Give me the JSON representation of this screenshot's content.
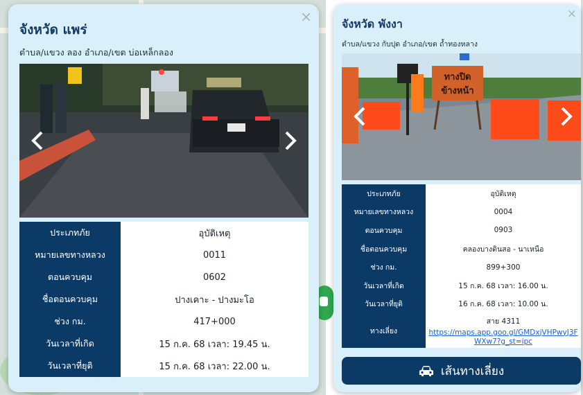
{
  "popups": [
    {
      "close_glyph": "×",
      "province": "จังหวัด แพร่",
      "location": "ตำบล/แขวง ลอง อำเภอ/เขต บ่อเหล็กลอง",
      "photo": "night-accident-road-photo",
      "rows": [
        {
          "label": "ประเภทภัย",
          "value": "อุบัติเหตุ"
        },
        {
          "label": "หมายเลขทางหลวง",
          "value": "0011"
        },
        {
          "label": "ตอนควบคุม",
          "value": "0602"
        },
        {
          "label": "ชื่อตอนควบคุม",
          "value": "ปางเคาะ - ปางมะโอ"
        },
        {
          "label": "ช่วง กม.",
          "value": "417+000"
        },
        {
          "label": "วันเวลาที่เกิด",
          "value": "15 ก.ค. 68 เวลา: 19.45 น."
        },
        {
          "label": "วันเวลาที่ยุติ",
          "value": "15 ก.ค. 68 เวลา: 22.00 น."
        }
      ]
    },
    {
      "close_glyph": "×",
      "province": "จังหวัด พังงา",
      "location": "ตำบล/แขวง กับปุด อำเภอ/เขต ถ้ำทองหลาง",
      "photo": "road-closure-barrier-photo",
      "sign_text": [
        "ทางปิด",
        "ข้างหน้า"
      ],
      "rows": [
        {
          "label": "ประเภทภัย",
          "value": "อุบัติเหตุ"
        },
        {
          "label": "หมายเลขทางหลวง",
          "value": "0004"
        },
        {
          "label": "ตอนควบคุม",
          "value": "0903"
        },
        {
          "label": "ชื่อตอนควบคุม",
          "value": "คลองบางดินสอ - นาเหนือ"
        },
        {
          "label": "ช่วง กม.",
          "value": "899+300"
        },
        {
          "label": "วันเวลาที่เกิด",
          "value": "15 ก.ค. 68 เวลา: 16.00 น."
        },
        {
          "label": "วันเวลาที่ยุติ",
          "value": "16 ก.ค. 68 เวลา: 10.00 น."
        }
      ],
      "detour": {
        "label": "ทางเลี่ยง",
        "route": "สาย 4311",
        "url": "https://maps.app.goo.gl/GMDxjVHPwyJ3FWXw7?g_st=ipc"
      },
      "detour_button": {
        "label": "เส้นทางเลี่ยง",
        "icon": "car-icon"
      }
    }
  ],
  "colors": {
    "popup_bg": "#d9f0fa",
    "header_navy": "#123a66",
    "table_label_bg": "#0c3a66",
    "link": "#1a5fd6",
    "map_marker": "#2fa84f"
  }
}
